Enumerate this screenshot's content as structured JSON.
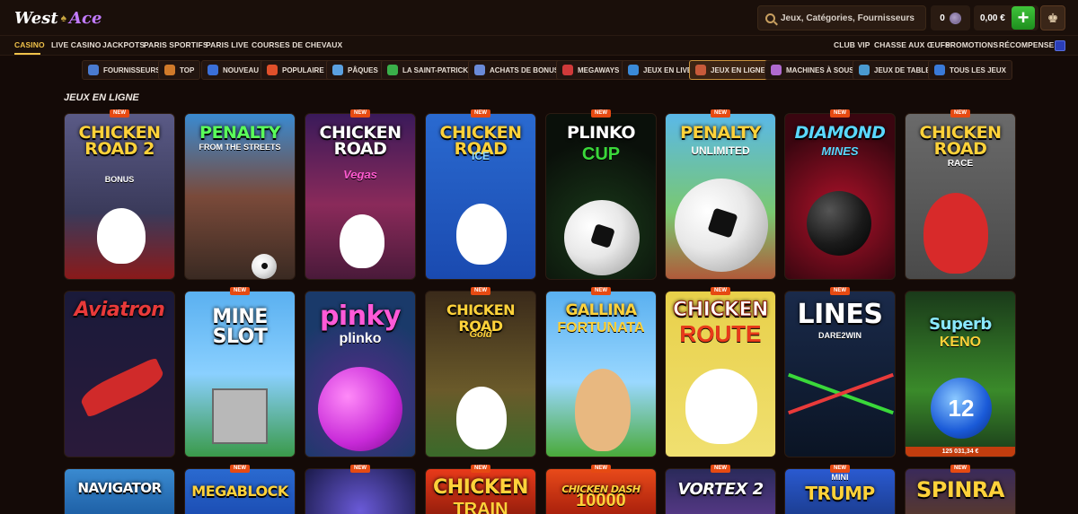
{
  "header": {
    "logo_part1": "West",
    "logo_part2": "Ace",
    "search_placeholder": "Jeux, Catégories, Fournisseurs",
    "points": "0",
    "balance": "0,00 €"
  },
  "nav": {
    "left": [
      "CASINO",
      "LIVE CASINO",
      "JACKPOTS",
      "PARIS SPORTIFS",
      "PARIS LIVE",
      "COURSES DE CHEVAUX"
    ],
    "right": [
      "CLUB VIP",
      "CHASSE AUX ŒUFS",
      "PROMOTIONS",
      "RÉCOMPENSES"
    ]
  },
  "categories": [
    {
      "label": "FOURNISSEURS",
      "icon": "providers-icon",
      "color": "#4a7bd0"
    },
    {
      "label": "TOP",
      "icon": "crown-icon",
      "color": "#d07a2a"
    },
    {
      "label": "NOUVEAU",
      "icon": "rocket-icon",
      "color": "#3a6fd8"
    },
    {
      "label": "POPULAIRE",
      "icon": "flame-icon",
      "color": "#e0502a"
    },
    {
      "label": "PÂQUES",
      "icon": "easter-egg-icon",
      "color": "#5aa0e0"
    },
    {
      "label": "LA SAINT-PATRICK",
      "icon": "clover-icon",
      "color": "#3ab04a"
    },
    {
      "label": "ACHATS DE BONUS",
      "icon": "bonus-icon",
      "color": "#6a8ad8"
    },
    {
      "label": "MEGAWAYS",
      "icon": "megaways-icon",
      "color": "#d03a3a"
    },
    {
      "label": "JEUX EN LIVE",
      "icon": "live-icon",
      "color": "#3a8ad8"
    },
    {
      "label": "JEUX EN LIGNE",
      "icon": "online-icon",
      "color": "#c85a3a"
    },
    {
      "label": "MACHINES À SOUS",
      "icon": "slot-machine-icon",
      "color": "#b06ad0"
    },
    {
      "label": "JEUX DE TABLE",
      "icon": "table-games-icon",
      "color": "#4a9ad0"
    },
    {
      "label": "TOUS LES JEUX",
      "icon": "all-games-icon",
      "color": "#3a7ad8"
    }
  ],
  "section_title": "JEUX EN LIGNE",
  "badge_new": "NEW",
  "games": [
    {
      "title": "CHICKEN ROAD 2",
      "sub": "BONUS",
      "new": true
    },
    {
      "title": "PENALTY",
      "sub": "FROM THE STREETS",
      "new": false
    },
    {
      "title": "CHICKEN ROAD",
      "sub": "Vegas",
      "new": true
    },
    {
      "title": "CHICKEN ROAD",
      "sub": "ICE",
      "new": true
    },
    {
      "title": "PLINKO",
      "sub": "CUP",
      "new": true
    },
    {
      "title": "PENALTY",
      "sub": "UNLIMITED",
      "new": true
    },
    {
      "title": "DIAMOND",
      "sub": "MINES",
      "new": true
    },
    {
      "title": "CHICKEN ROAD",
      "sub": "RACE",
      "new": true
    },
    {
      "title": "Aviatron",
      "sub": "",
      "new": false
    },
    {
      "title": "MINE SLOT",
      "sub": "",
      "new": true
    },
    {
      "title": "pinky",
      "sub": "plinko",
      "new": false
    },
    {
      "title": "CHICKEN ROAD",
      "sub": "Gold",
      "new": true
    },
    {
      "title": "GALLINA",
      "sub": "FORTUNATA",
      "new": true
    },
    {
      "title": "CHICKEN",
      "sub": "ROUTE",
      "new": true
    },
    {
      "title": "LINES",
      "sub": "DARE2WIN",
      "new": true
    },
    {
      "title": "Superb",
      "sub": "KENO",
      "new": false,
      "jackpot": "125 031,34 €"
    },
    {
      "title": "NAVIGATOR",
      "sub": "",
      "new": false
    },
    {
      "title": "MEGABLOCK",
      "sub": "",
      "new": true
    },
    {
      "title": "",
      "sub": "",
      "new": true
    },
    {
      "title": "CHICKEN",
      "sub": "TRAIN",
      "new": true
    },
    {
      "title": "CHICKEN DASH",
      "sub": "10000",
      "new": true
    },
    {
      "title": "VORTEX 2",
      "sub": "",
      "new": true
    },
    {
      "title": "MINI",
      "sub": "TRUMP",
      "new": true
    },
    {
      "title": "SPINRA",
      "sub": "",
      "new": true
    }
  ]
}
